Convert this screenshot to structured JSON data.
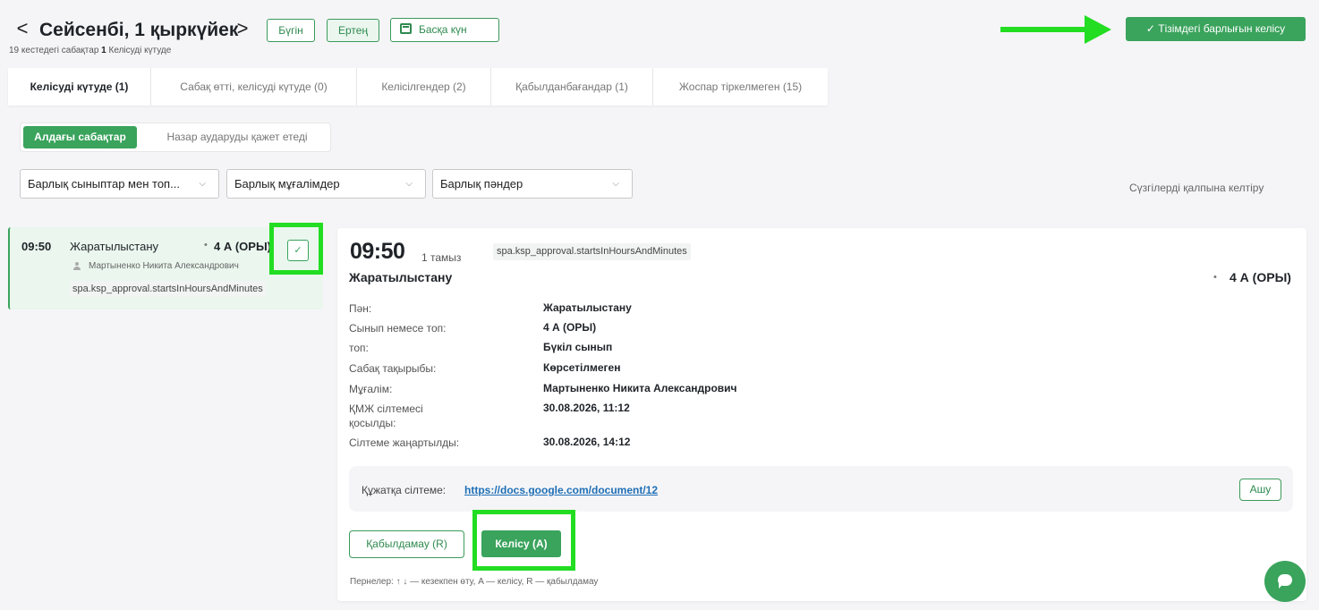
{
  "header": {
    "back_glyph": "<",
    "forward_glyph": ">",
    "title": "Сейсенбі, 1 қыркүйек",
    "subtitle_prefix": "19 кестедегі сабақтар",
    "subtitle_count": "1",
    "subtitle_suffix": "Келісуді күтуде",
    "today_label": "Бүгін",
    "tomorrow_label": "Ертең",
    "other_day_label": "Басқа күн",
    "approve_all_label": "✓ Тізімдегі барлығын келісу"
  },
  "tabs": [
    {
      "label": "Келісуді күтуде (1)",
      "active": true
    },
    {
      "label": "Сабақ өтті, келісуді күтуде (0)",
      "active": false
    },
    {
      "label": "Келісілгендер (2)",
      "active": false
    },
    {
      "label": "Қабылданбағандар (1)",
      "active": false
    },
    {
      "label": "Жоспар тіркелмеген (15)",
      "active": false
    }
  ],
  "segment": {
    "upcoming_label": "Алдағы сабақтар",
    "attention_label": "Назар аударуды қажет етеді"
  },
  "filters": {
    "classes": "Барлық сыныптар мен топ...",
    "teachers": "Барлық мұғалімдер",
    "subjects": "Барлық пәндер",
    "chevron": "⌵",
    "reset_label": "Сүзгілерді қалпына келтіру"
  },
  "lesson_card": {
    "time": "09:50",
    "subject": "Жаратылыстану",
    "dot": "•",
    "class": "4 А (ОРЫ)",
    "teacher": "Мартыненко Никита Александрович",
    "tag": "spa.ksp_approval.startsInHoursAndMinutes",
    "check_glyph": "✓"
  },
  "detail": {
    "time": "09:50",
    "date": "1 тамыз",
    "tag": "spa.ksp_approval.startsInHoursAndMinutes",
    "subject": "Жаратылыстану",
    "dot": "•",
    "class": "4 А (ОРЫ)",
    "fields": [
      {
        "label": "Пән:",
        "value": "Жаратылыстану"
      },
      {
        "label": "Сынып немесе топ:",
        "value": "4 А (ОРЫ)"
      },
      {
        "label": "топ:",
        "value": "Бүкіл сынып"
      },
      {
        "label": "Сабақ тақырыбы:",
        "value": "Көрсетілмеген"
      },
      {
        "label": "Мұғалім:",
        "value": "Мартыненко Никита Александрович"
      },
      {
        "label": "ҚМЖ сілтемесі қосылды:",
        "value": "30.08.2026, 11:12"
      },
      {
        "label": "Сілтеме жаңартылды:",
        "value": "30.08.2026, 14:12"
      }
    ],
    "doc_label": "Құжатқа сілтеме:",
    "doc_link": "https://docs.google.com/document/12",
    "open_label": "Ашу",
    "reject_label": "Қабылдамау (R)",
    "approve_label": "Келісу (A)",
    "hotkeys": "Пернелер: ↑ ↓ — кезекпен өту, A — келісу, R — қабылдамау"
  },
  "colors": {
    "accent": "#3aa35c",
    "highlight": "#22dd22",
    "link": "#1f6fb5"
  }
}
